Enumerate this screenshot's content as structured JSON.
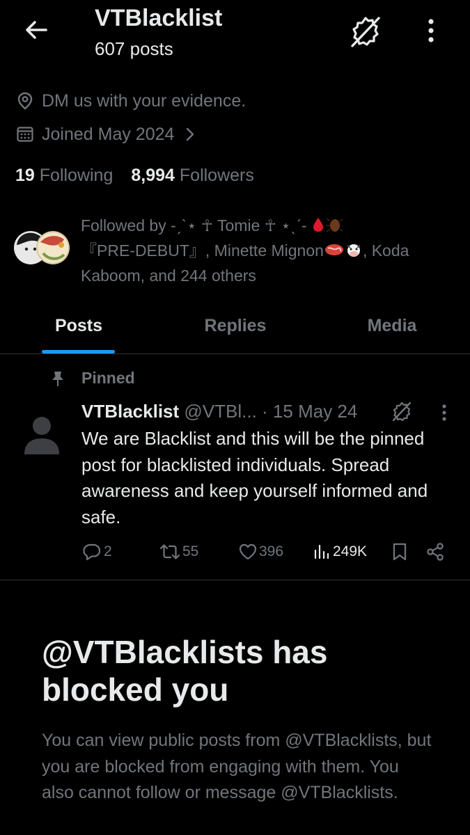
{
  "header": {
    "title": "VTBlacklist",
    "posts_count": "607 posts"
  },
  "profile": {
    "location": "DM us with your evidence.",
    "joined": "Joined May 2024",
    "following_count": "19",
    "following_label": "Following",
    "followers_count": "8,994",
    "followers_label": "Followers"
  },
  "followed_by": {
    "prefix": "Followed by -ˏˋ⋆ ☥ Tomie ☥ ⋆ˎˊ- ",
    "part2": "『PRE-DEBUT』, Minette Mignon",
    "part3": ", Koda Kaboom, and 244 others"
  },
  "tabs": [
    {
      "label": "Posts",
      "active": true
    },
    {
      "label": "Replies",
      "active": false
    },
    {
      "label": "Media",
      "active": false
    }
  ],
  "pinned_post": {
    "pinned_label": "Pinned",
    "author": "VTBlacklist",
    "handle": "@VTBl...",
    "date": "· 15 May 24",
    "text": "We are Blacklist and this will be the pinned post for blacklisted individuals. Spread awareness and keep yourself informed and safe.",
    "replies": "2",
    "reposts": "55",
    "likes": "396",
    "views": "249K"
  },
  "blocked": {
    "title": "@VTBlacklists has blocked you",
    "message": "You can view public posts from @VTBlacklists, but you are blocked from engaging with them. You also cannot follow or message @VTBlacklists."
  },
  "colors": {
    "background": "#000000",
    "text_primary": "#e7e9ea",
    "text_secondary": "#71767b",
    "accent": "#1d9bf0",
    "divider": "#2f3336"
  }
}
